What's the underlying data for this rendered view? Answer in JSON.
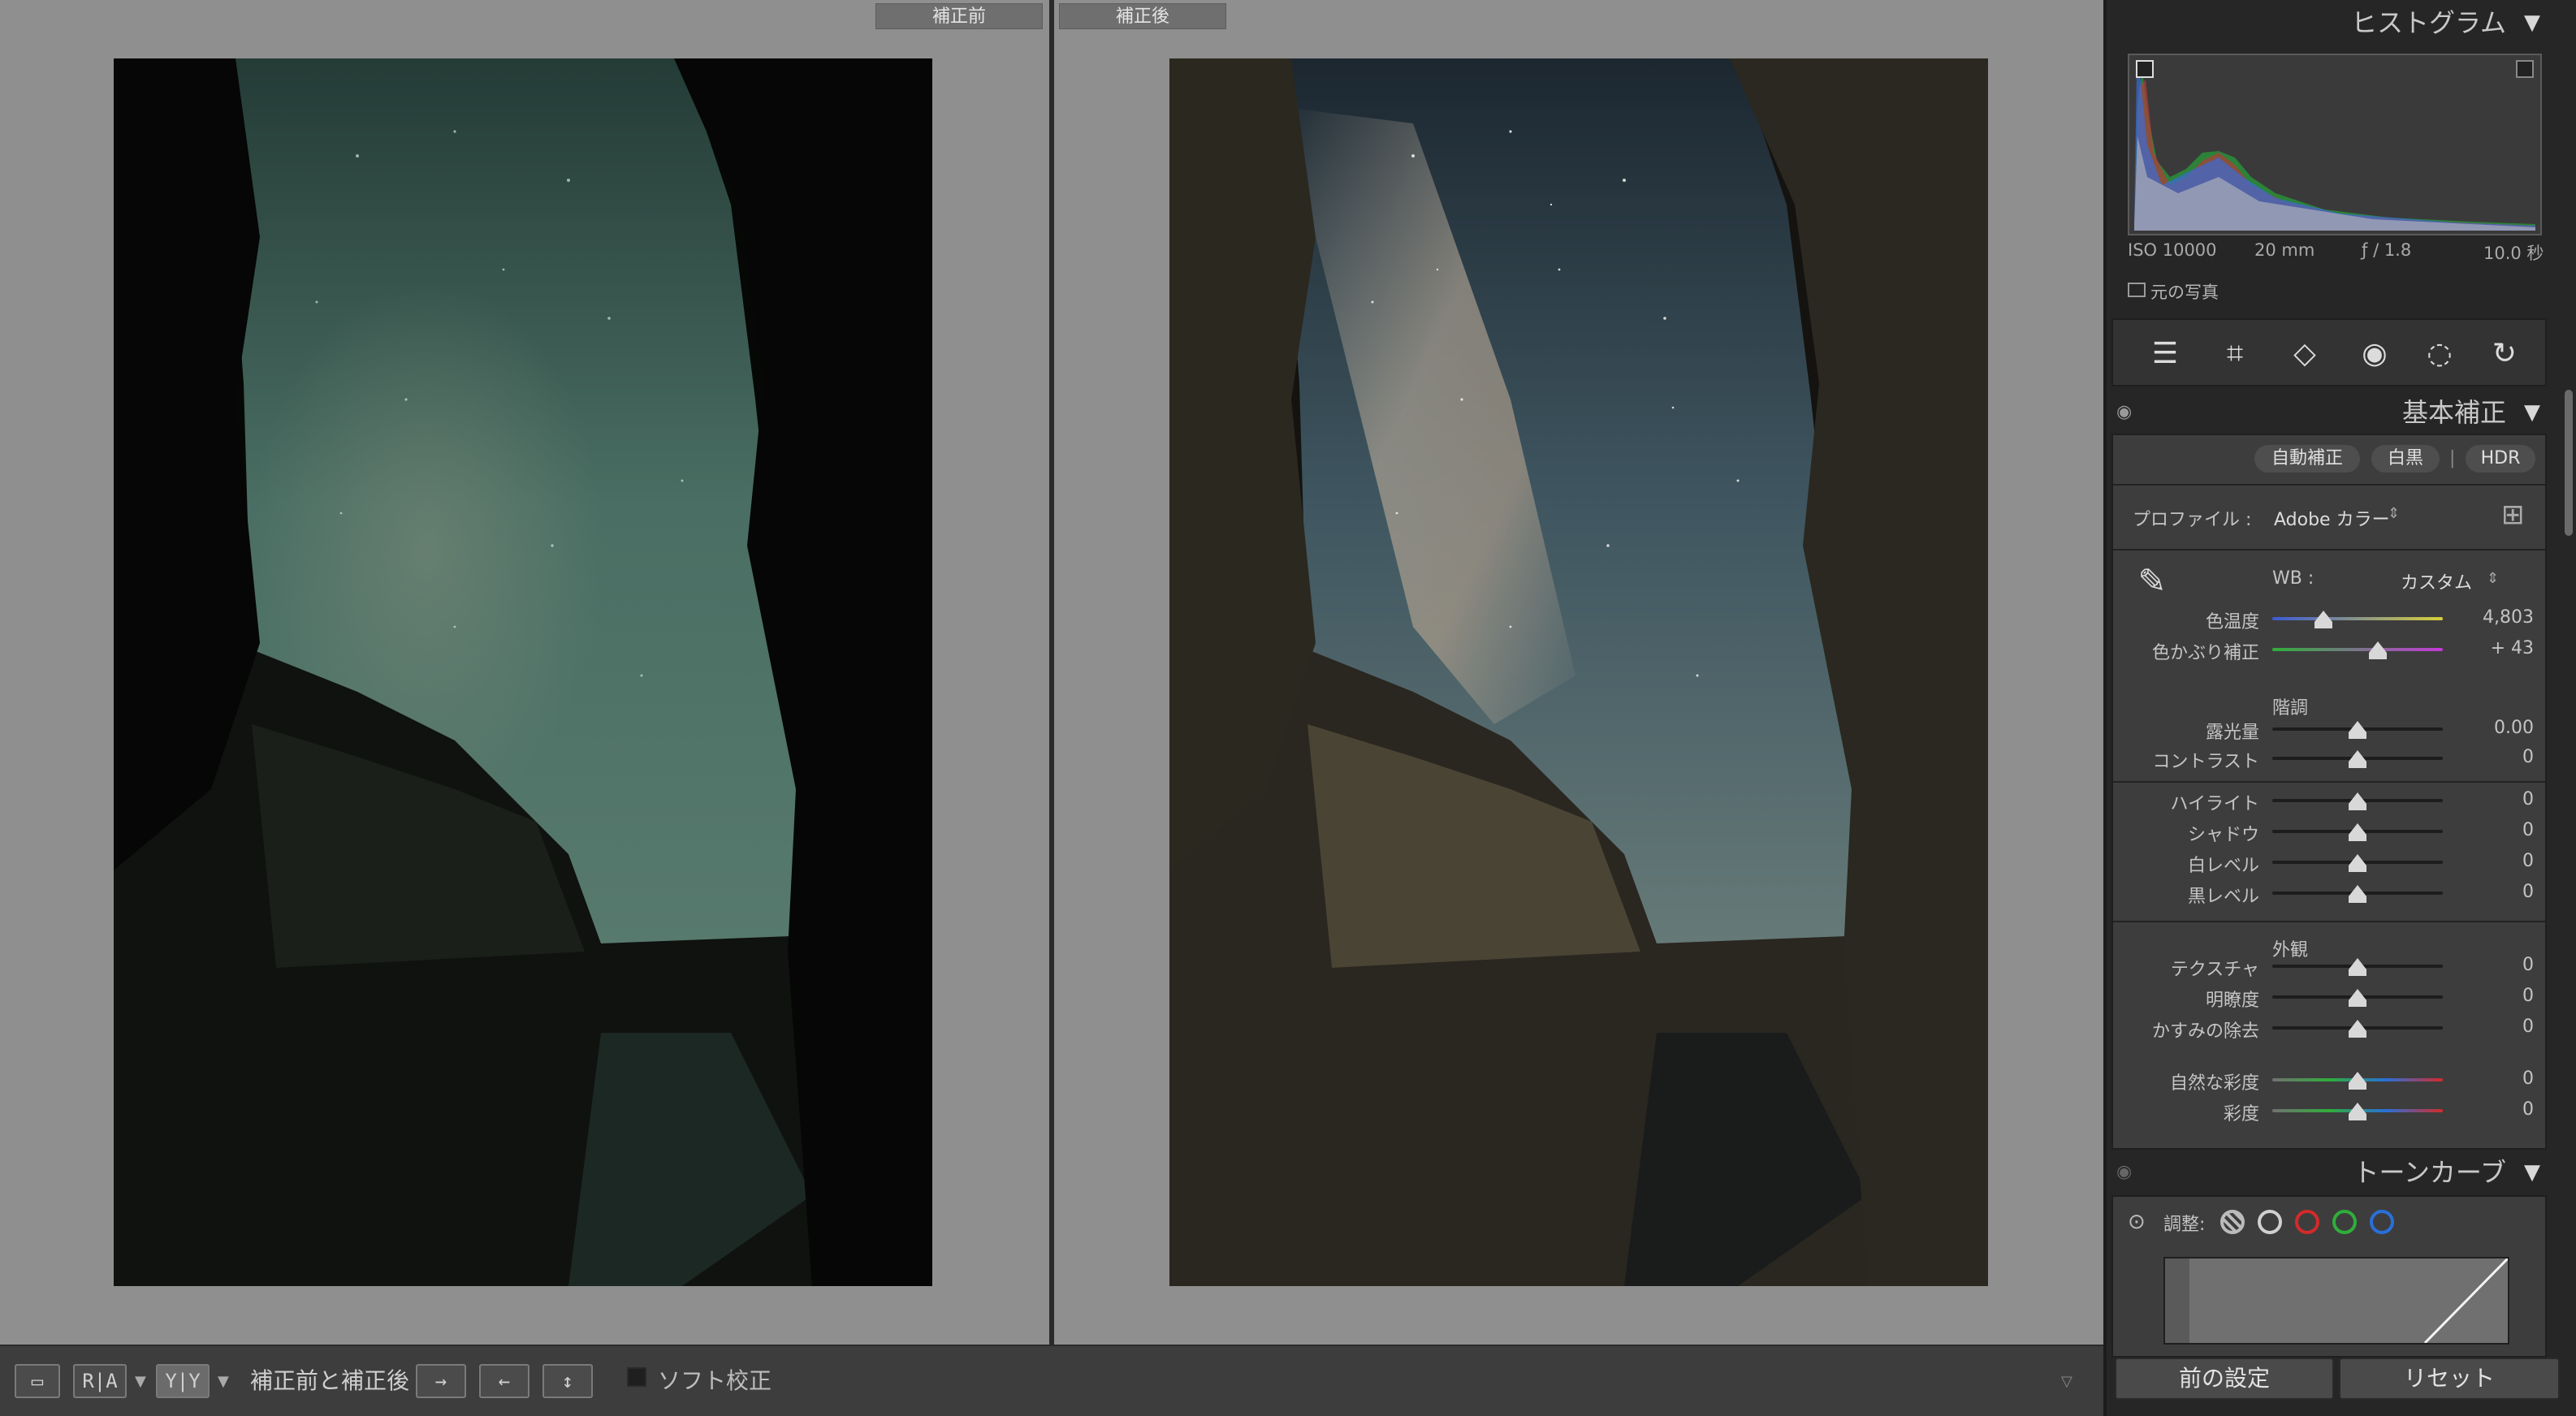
{
  "compare": {
    "before_label": "補正前",
    "after_label": "補正後"
  },
  "toolbar": {
    "view_loupe_icon": "loupe-view-icon",
    "view_ra": "R|A",
    "view_yy": "Y|Y",
    "before_after_label": "補正前と補正後 :",
    "softproof_label": "ソフト校正"
  },
  "histogram": {
    "title": "ヒストグラム",
    "iso": "ISO 10000",
    "focal": "20 mm",
    "aperture": "ƒ / 1.8",
    "shutter": "10.0 秒",
    "original_photo": "元の写真"
  },
  "tools": [
    "develop-sliders-icon",
    "crop-icon",
    "eraser-icon",
    "red-eye-icon",
    "mask-icon",
    "reset-rotate-icon"
  ],
  "basic": {
    "title": "基本補正",
    "auto": "自動補正",
    "bw": "白黒",
    "hdr": "HDR",
    "profile_label": "プロファイル :",
    "profile_value": "Adobe カラー",
    "wb_label": "WB :",
    "wb_value": "カスタム",
    "temp_label": "色温度",
    "temp_value": "4,803",
    "temp_level": 0.3,
    "tint_label": "色かぶり補正",
    "tint_value": "+ 43",
    "tint_level": 0.62,
    "tone_group": "階調",
    "exposure_label": "露光量",
    "exposure_value": "0.00",
    "contrast_label": "コントラスト",
    "contrast_value": "0",
    "highlights_label": "ハイライト",
    "highlights_value": "0",
    "shadows_label": "シャドウ",
    "shadows_value": "0",
    "whites_label": "白レベル",
    "whites_value": "0",
    "blacks_label": "黒レベル",
    "blacks_value": "0",
    "presence_group": "外観",
    "texture_label": "テクスチャ",
    "texture_value": "0",
    "clarity_label": "明瞭度",
    "clarity_value": "0",
    "dehaze_label": "かすみの除去",
    "dehaze_value": "0",
    "vibrance_label": "自然な彩度",
    "vibrance_value": "0",
    "saturation_label": "彩度",
    "saturation_value": "0"
  },
  "tonecurve": {
    "title": "トーンカーブ",
    "adjust_label": "調整:"
  },
  "bottom": {
    "previous": "前の設定",
    "reset": "リセット"
  },
  "colors": {
    "panel_bg": "#262626",
    "section_bg": "#3d3d3d",
    "compare_bg": "#8f8f8f",
    "curve_red": "#d42a2a",
    "curve_green": "#2fae3a",
    "curve_blue": "#2a6fd8"
  }
}
